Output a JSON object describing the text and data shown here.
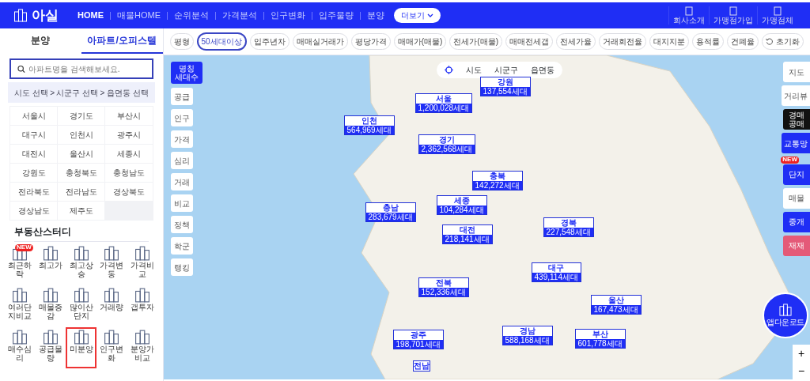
{
  "header": {
    "logo_text": "아실",
    "nav": [
      {
        "label": "HOME",
        "selected": true
      },
      {
        "label": "매물HOME",
        "selected": false
      },
      {
        "label": "순위분석",
        "selected": false
      },
      {
        "label": "가격분석",
        "selected": false
      },
      {
        "label": "인구변화",
        "selected": false
      },
      {
        "label": "입주물량",
        "selected": false
      },
      {
        "label": "분양",
        "selected": false
      }
    ],
    "more_button": "더보기",
    "right_links": [
      "회사소개",
      "가맹점가입",
      "가맹점체"
    ]
  },
  "sidebar": {
    "tabs": [
      {
        "label": "분양",
        "selected": false
      },
      {
        "label": "아파트/오피스텔",
        "selected": true
      }
    ],
    "search": {
      "placeholder": "아파트명을 검색해보세요."
    },
    "breadcrumb": [
      "시도 선택",
      "시군구 선택",
      "읍면동 선택"
    ],
    "breadcrumb_separator": ">",
    "regions": [
      "서울시",
      "경기도",
      "부산시",
      "대구시",
      "인천시",
      "광주시",
      "대전시",
      "울산시",
      "세종시",
      "강원도",
      "충청북도",
      "충청남도",
      "전라북도",
      "전라남도",
      "경상북도",
      "경상남도",
      "제주도"
    ],
    "study_title": "부동산스터디",
    "study_items": [
      {
        "label": "최근하락",
        "badge": "NEW",
        "selected": false
      },
      {
        "label": "최고가",
        "selected": false
      },
      {
        "label": "최고상승",
        "selected": false
      },
      {
        "label": "가격변동",
        "selected": false
      },
      {
        "label": "가격비교",
        "selected": false
      },
      {
        "label": "여러단지비교",
        "selected": false
      },
      {
        "label": "매물증감",
        "selected": false
      },
      {
        "label": "많이산단지",
        "selected": false
      },
      {
        "label": "거래량",
        "selected": false
      },
      {
        "label": "갭투자",
        "selected": false
      },
      {
        "label": "매수심리",
        "selected": false
      },
      {
        "label": "공급물량",
        "selected": false
      },
      {
        "label": "미분양",
        "selected": true
      },
      {
        "label": "인구변화",
        "selected": false
      },
      {
        "label": "분양가비교",
        "selected": false
      }
    ]
  },
  "filters": {
    "chips": [
      {
        "label": "평형",
        "selected": false
      },
      {
        "label": "50세대이상",
        "selected": true
      },
      {
        "label": "입주년차",
        "selected": false
      },
      {
        "label": "매매실거래가",
        "selected": false
      },
      {
        "label": "평당가격",
        "selected": false
      },
      {
        "label": "매매가(매물)",
        "selected": false
      },
      {
        "label": "전세가(매물)",
        "selected": false
      },
      {
        "label": "매매전세갭",
        "selected": false
      },
      {
        "label": "전세가율",
        "selected": false
      },
      {
        "label": "거래회전율",
        "selected": false
      },
      {
        "label": "대지지분",
        "selected": false
      },
      {
        "label": "용적률",
        "selected": false
      },
      {
        "label": "건폐율",
        "selected": false
      }
    ],
    "reset": "초기화"
  },
  "map": {
    "levels": [
      "시도",
      "시군구",
      "읍면동"
    ],
    "layers": [
      {
        "label": "명칭",
        "sublabel": "세대수",
        "selected": true
      },
      {
        "label": "공급",
        "selected": false
      },
      {
        "label": "인구",
        "selected": false
      },
      {
        "label": "가격",
        "selected": false
      },
      {
        "label": "심리",
        "selected": false
      },
      {
        "label": "거래",
        "selected": false
      },
      {
        "label": "비교",
        "selected": false
      },
      {
        "label": "정책",
        "selected": false
      },
      {
        "label": "학군",
        "selected": false
      },
      {
        "label": "랭킹",
        "selected": false
      }
    ],
    "markers": [
      {
        "region": "강원",
        "count": "137,554세대"
      },
      {
        "region": "서울",
        "count": "1,200,028세대"
      },
      {
        "region": "인천",
        "count": "564,969세대"
      },
      {
        "region": "경기",
        "count": "2,362,568세대"
      },
      {
        "region": "충북",
        "count": "142,272세대"
      },
      {
        "region": "세종",
        "count": "104,284세대"
      },
      {
        "region": "충남",
        "count": "283,679세대"
      },
      {
        "region": "대전",
        "count": "218,141세대"
      },
      {
        "region": "경북",
        "count": "227,548세대"
      },
      {
        "region": "대구",
        "count": "439,114세대"
      },
      {
        "region": "전북",
        "count": "152,336세대"
      },
      {
        "region": "울산",
        "count": "167,473세대"
      },
      {
        "region": "광주",
        "count": "198,701세대"
      },
      {
        "region": "경남",
        "count": "588,168세대"
      },
      {
        "region": "부산",
        "count": "601,778세대"
      },
      {
        "region": "전남"
      }
    ],
    "tools": [
      {
        "label": "지도",
        "kind": "plain"
      },
      {
        "label": "거리뷰",
        "kind": "icon"
      },
      {
        "label": "경매",
        "sublabel": "공매",
        "kind": "dark"
      },
      {
        "label": "교통망",
        "kind": "blue-icon"
      },
      {
        "label": "단지",
        "kind": "blue",
        "badge": "NEW"
      },
      {
        "label": "매물",
        "kind": "plain"
      },
      {
        "label": "중개",
        "kind": "blue"
      },
      {
        "label": "재재",
        "kind": "pink"
      }
    ],
    "app_download": "앱다운로드",
    "zoom_in": "+",
    "zoom_out": "−"
  }
}
